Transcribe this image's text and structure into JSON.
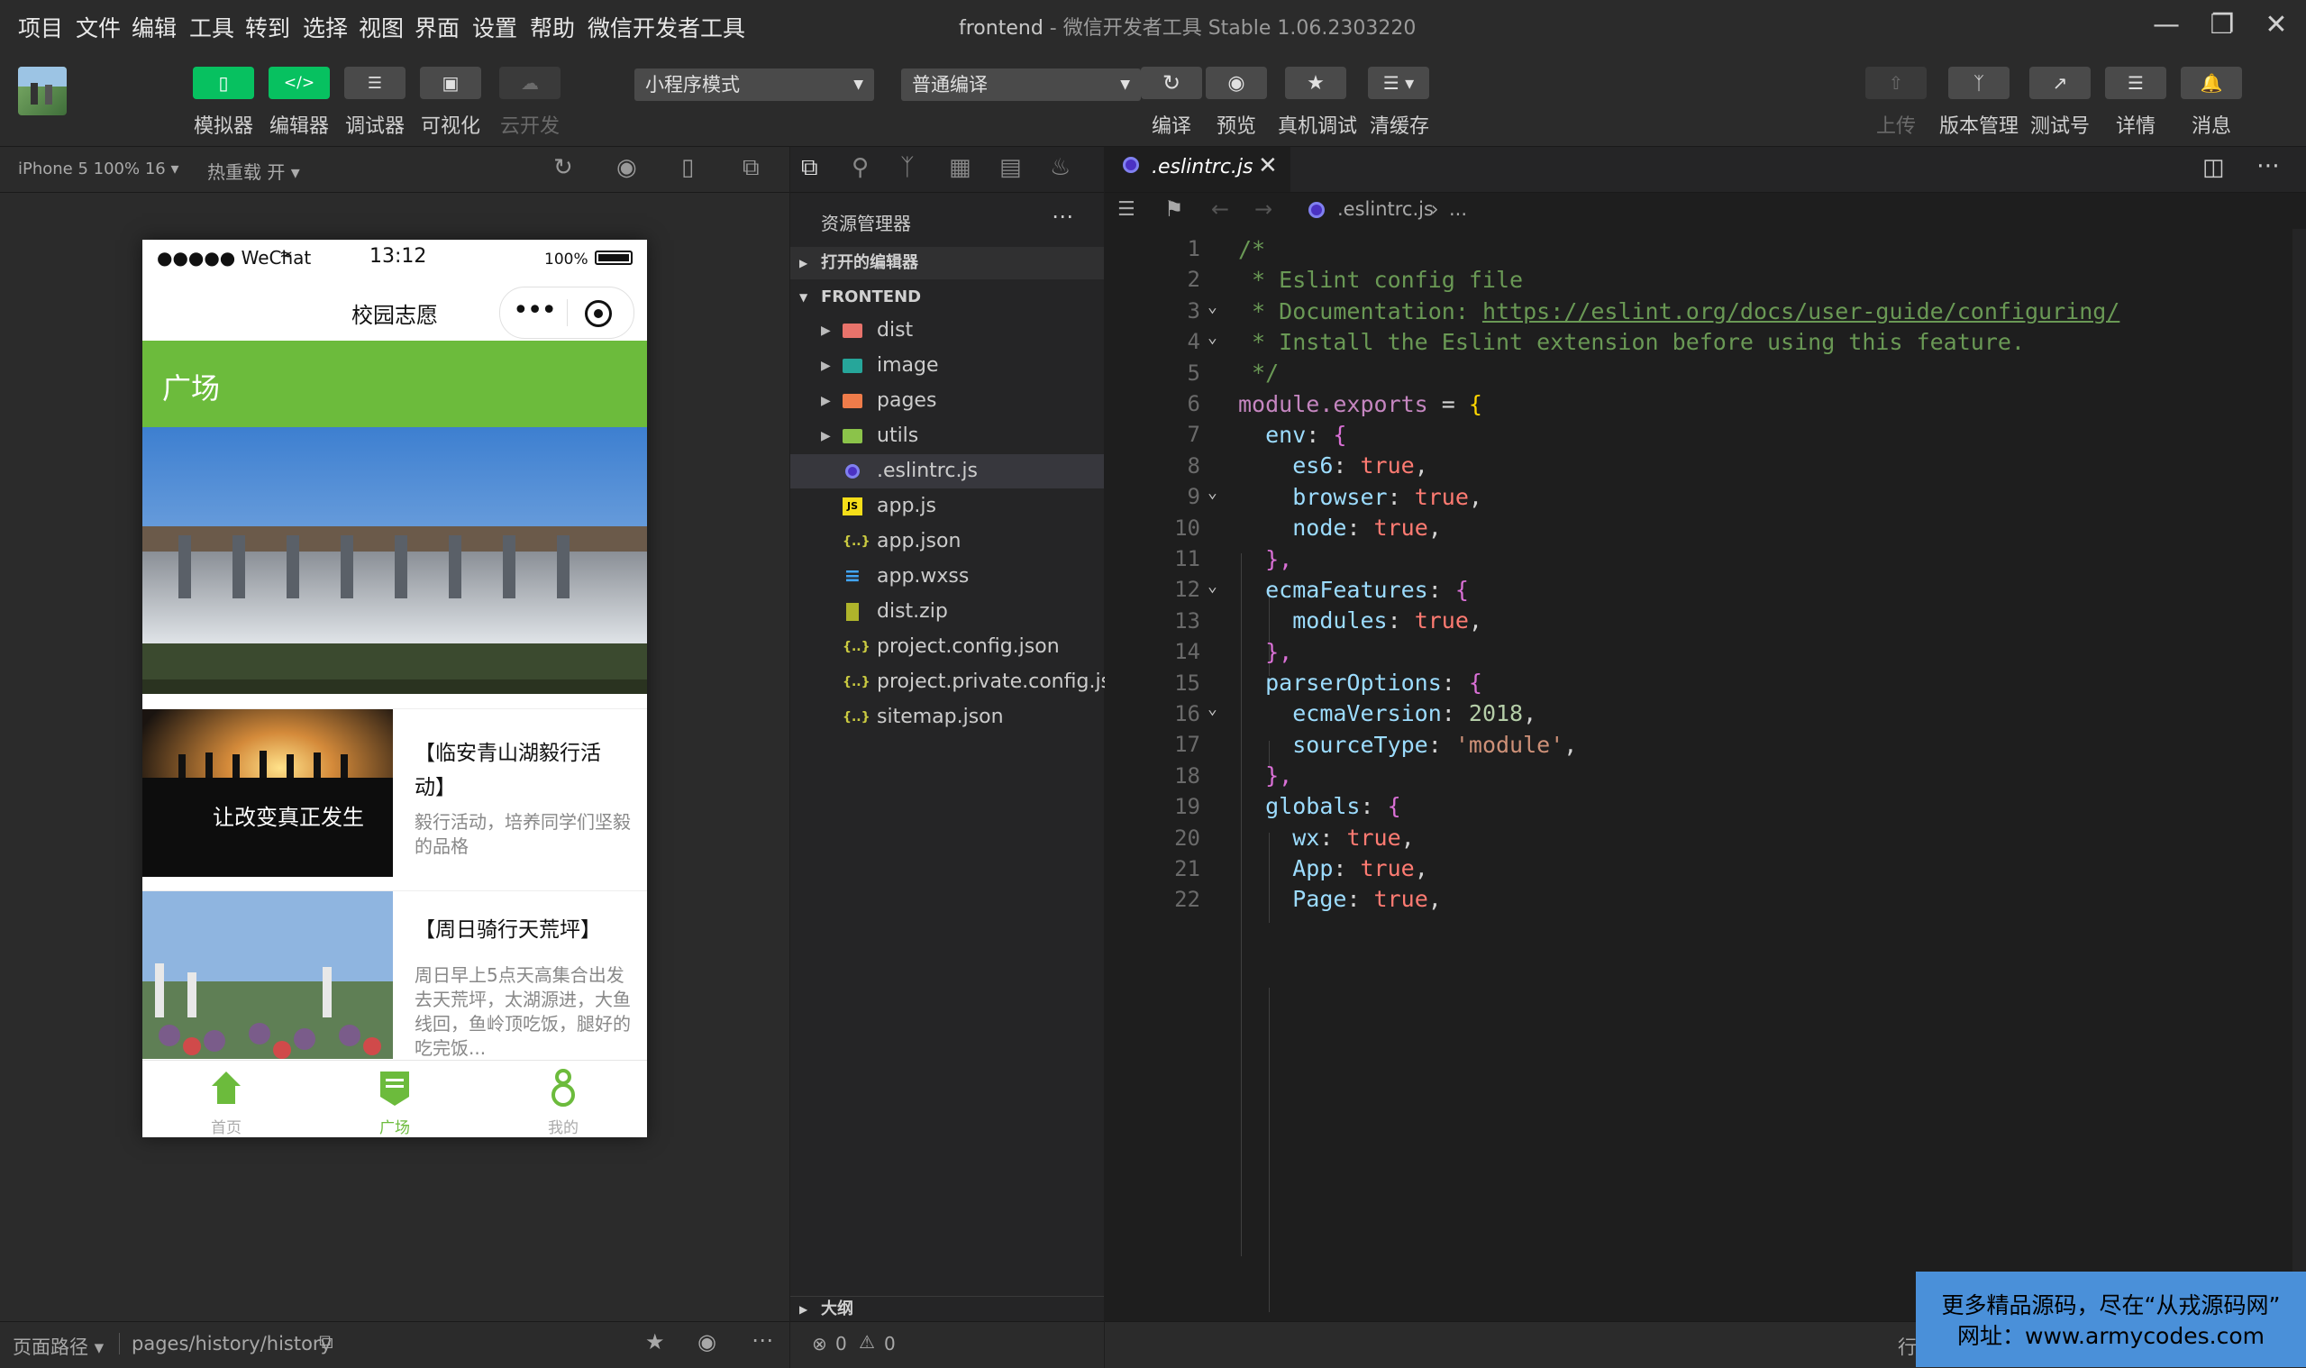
{
  "menu": [
    "项目",
    "文件",
    "编辑",
    "工具",
    "转到",
    "选择",
    "视图",
    "界面",
    "设置",
    "帮助",
    "微信开发者工具"
  ],
  "window": {
    "project": "frontend",
    "app": "微信开发者工具 Stable 1.06.2303220"
  },
  "toolbar": {
    "left_buttons": [
      {
        "label": "模拟器",
        "icon": "phone-icon"
      },
      {
        "label": "编辑器",
        "icon": "code-icon"
      },
      {
        "label": "调试器",
        "icon": "debug-icon"
      },
      {
        "label": "可视化",
        "icon": "layout-icon"
      },
      {
        "label": "云开发",
        "icon": "cloud-icon"
      }
    ],
    "mode_select": "小程序模式",
    "compile_select": "普通编译",
    "mid_buttons": [
      {
        "label": "编译",
        "icon": "refresh-icon"
      },
      {
        "label": "预览",
        "icon": "eye-icon"
      },
      {
        "label": "真机调试",
        "icon": "bug-icon"
      },
      {
        "label": "清缓存",
        "icon": "layers-icon"
      }
    ],
    "right_buttons": [
      {
        "label": "上传",
        "icon": "upload-icon"
      },
      {
        "label": "版本管理",
        "icon": "branch-icon"
      },
      {
        "label": "测试号",
        "icon": "external-icon"
      },
      {
        "label": "详情",
        "icon": "menu-icon"
      },
      {
        "label": "消息",
        "icon": "bell-icon"
      }
    ]
  },
  "simulator": {
    "device": "iPhone 5 100% 16 ▾",
    "hot_reload": "热重载 开 ▾",
    "status": {
      "carrier": "●●●●● WeChat",
      "time": "13:12",
      "battery": "100%"
    },
    "nav_title": "校园志愿",
    "page_header": "广场",
    "cards": [
      {
        "title": "【临安青山湖毅行活动】",
        "desc": "毅行活动，培养同学们坚毅的品格",
        "thumb_text": "让改变真正发生"
      },
      {
        "title": "【周日骑行天荒坪】",
        "desc": "周日早上5点天高集合出发去天荒坪，太湖源进，大鱼线回，鱼岭顶吃饭，腿好的吃完饭..."
      }
    ],
    "tabs": [
      {
        "label": "首页",
        "icon": "home-icon"
      },
      {
        "label": "广场",
        "icon": "square-doc-icon"
      },
      {
        "label": "我的",
        "icon": "user-icon"
      }
    ],
    "footer": {
      "path_label": "页面路径 ▾",
      "path": "pages/history/history"
    }
  },
  "explorer": {
    "title": "资源管理器",
    "open_editors": "打开的编辑器",
    "root": "FRONTEND",
    "items": [
      {
        "name": "dist",
        "type": "folder",
        "color": "#e8736b"
      },
      {
        "name": "image",
        "type": "folder",
        "color": "#26a69a"
      },
      {
        "name": "pages",
        "type": "folder",
        "color": "#ef7c4a"
      },
      {
        "name": "utils",
        "type": "folder",
        "color": "#8bc34a"
      },
      {
        "name": ".eslintrc.js",
        "type": "eslint",
        "color": "#4b32c3"
      },
      {
        "name": "app.js",
        "type": "js",
        "color": "#f5de19"
      },
      {
        "name": "app.json",
        "type": "json",
        "color": "#cbcb41"
      },
      {
        "name": "app.wxss",
        "type": "css",
        "color": "#42a5f5"
      },
      {
        "name": "dist.zip",
        "type": "zip",
        "color": "#afb42b"
      },
      {
        "name": "project.config.json",
        "type": "json",
        "color": "#cbcb41"
      },
      {
        "name": "project.private.config.js...",
        "type": "json",
        "color": "#cbcb41"
      },
      {
        "name": "sitemap.json",
        "type": "json",
        "color": "#cbcb41"
      }
    ],
    "outline": "大纲",
    "problems": {
      "errors": "0",
      "warnings": "0"
    }
  },
  "editor": {
    "tab": ".eslintrc.js",
    "breadcrumb": ".eslintrc.js",
    "breadcrumb_more": "...",
    "status_right": "行"
  },
  "code_lines": [
    "1",
    "2",
    "3",
    "4",
    "5",
    "6",
    "7",
    "8",
    "9",
    "10",
    "11",
    "12",
    "13",
    "14",
    "15",
    "16",
    "17",
    "18",
    "19",
    "20",
    "21",
    "22"
  ],
  "code": {
    "l1": "/*",
    "l2": " * Eslint config file",
    "l3a": " * Documentation: ",
    "l3b": "https://eslint.org/docs/user-guide/configuring/",
    "l4": " * Install the Eslint extension before using this feature.",
    "l5": " */",
    "l6a": "module",
    "l6b": ".exports",
    "l6c": " = ",
    "l6d": "{",
    "l7a": "env",
    "l7b": ": ",
    "l7c": "{",
    "l8a": "es6",
    "l8b": "true",
    "l9a": "browser",
    "l9b": "true",
    "l10a": "node",
    "l10b": "true",
    "l11": "},",
    "l12a": "ecmaFeatures",
    "l12c": "{",
    "l13a": "modules",
    "l13b": "true",
    "l14": "},",
    "l15a": "parserOptions",
    "l15c": "{",
    "l16a": "ecmaVersion",
    "l16b": "2018",
    "l17a": "sourceType",
    "l17b": "'module'",
    "l18": "},",
    "l19a": "globals",
    "l19c": "{",
    "l20a": "wx",
    "l20b": "true",
    "l21a": "App",
    "l21b": "true",
    "l22a": "Page",
    "l22b": "true"
  },
  "watermark": {
    "line1": "更多精品源码，尽在“从戎源码网”",
    "line2": "网址：www.armycodes.com"
  }
}
